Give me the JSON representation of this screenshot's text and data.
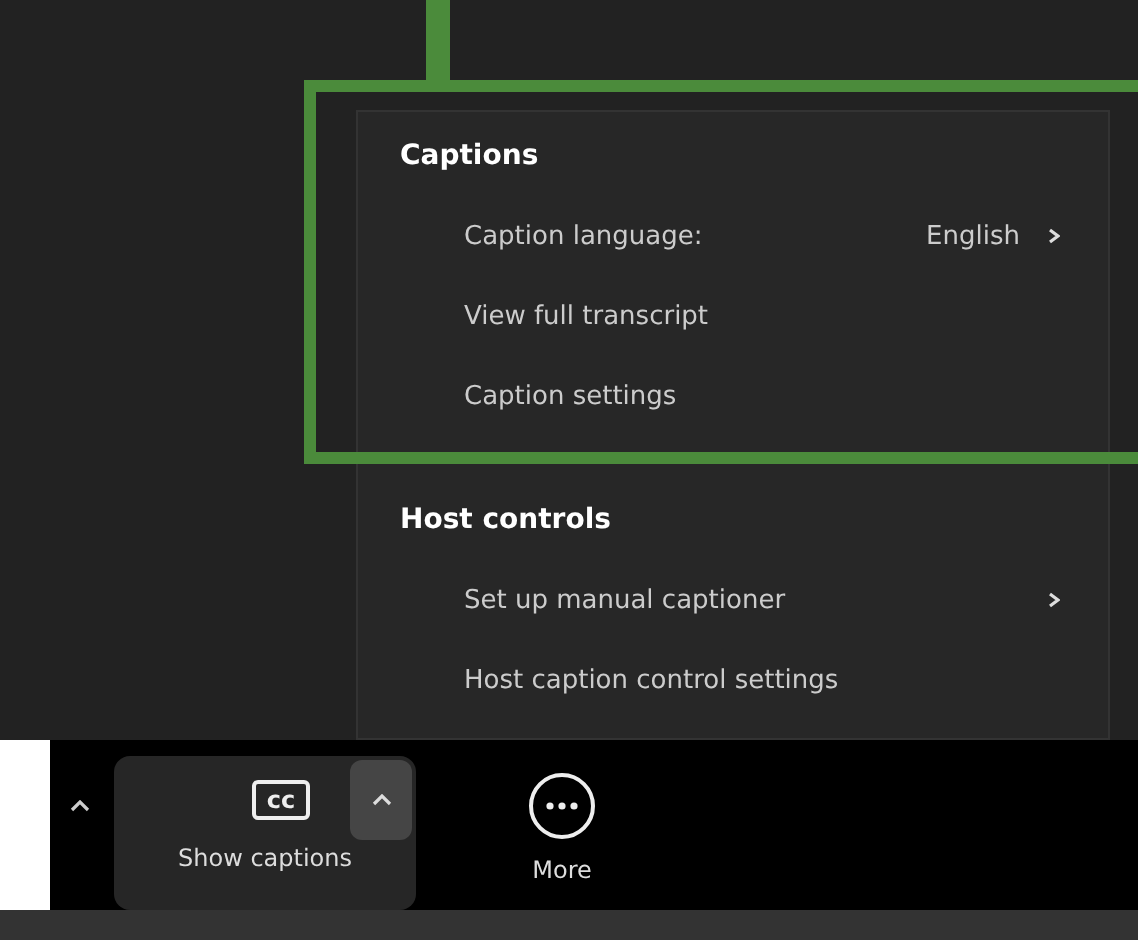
{
  "menu": {
    "sections": [
      {
        "title": "Captions",
        "items": [
          {
            "label": "Caption language:",
            "value": "English",
            "submenu": true
          },
          {
            "label": "View full transcript",
            "submenu": false
          },
          {
            "label": "Caption settings",
            "submenu": false
          }
        ]
      },
      {
        "title": "Host controls",
        "items": [
          {
            "label": "Set up manual captioner",
            "submenu": true
          },
          {
            "label": "Host caption control settings",
            "submenu": false
          }
        ]
      }
    ]
  },
  "toolbar": {
    "buttons": [
      {
        "kind": "captions",
        "icon_text": "cc",
        "label": "Show captions"
      },
      {
        "kind": "more",
        "label": "More"
      }
    ]
  }
}
